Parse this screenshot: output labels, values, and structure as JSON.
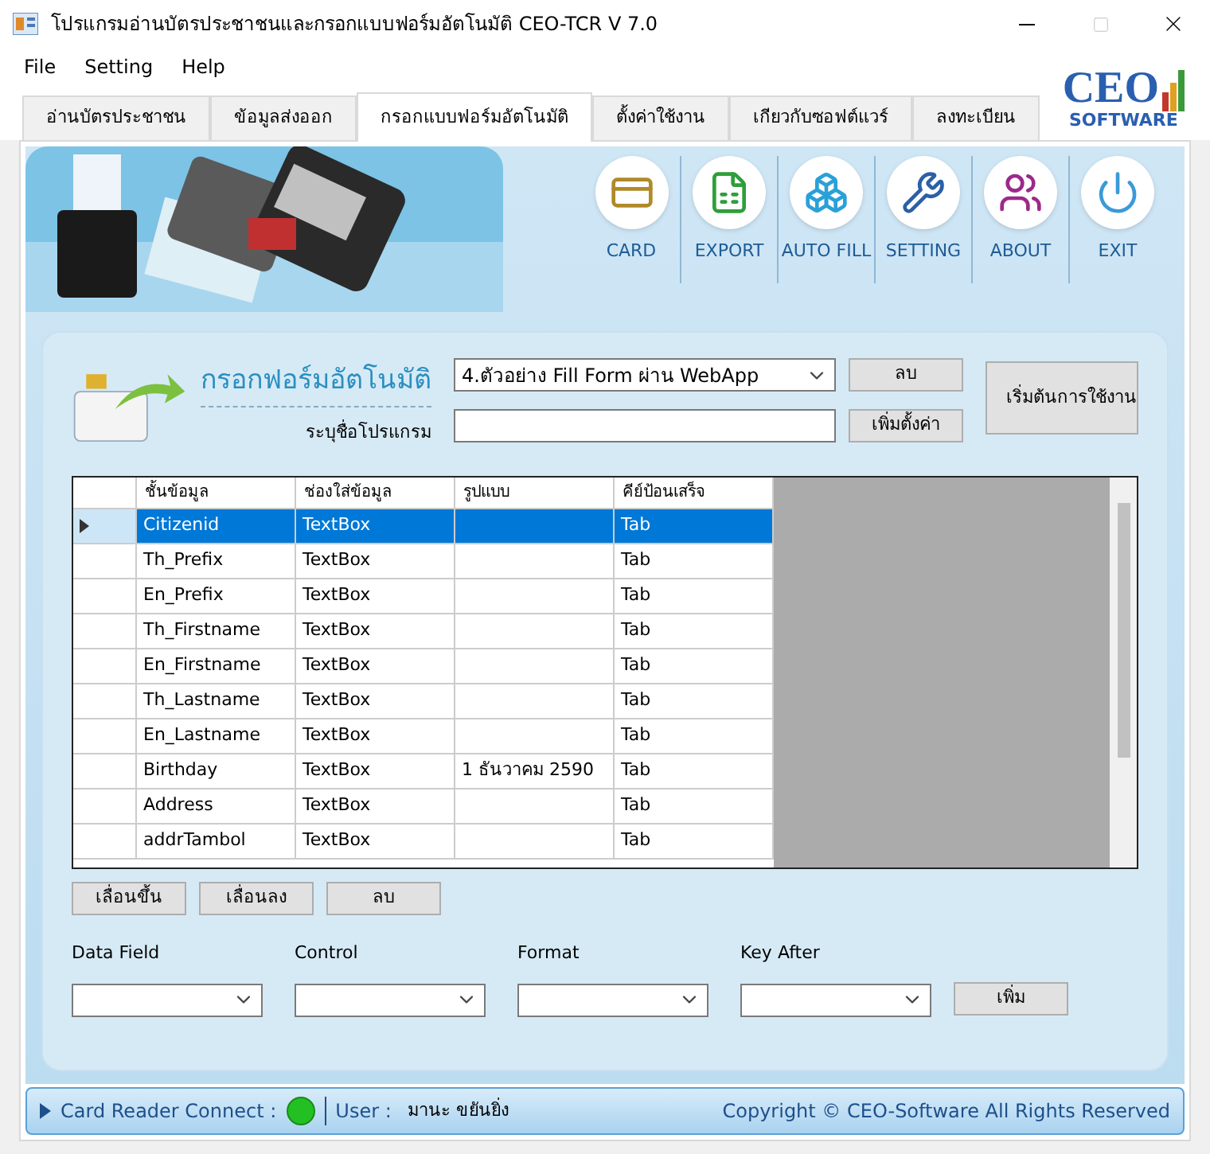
{
  "window": {
    "title": "โปรแกรมอ่านบัตรประชาชนและกรอกแบบฟอร์มอัตโนมัติ CEO-TCR V 7.0"
  },
  "menu": [
    "File",
    "Setting",
    "Help"
  ],
  "logo": {
    "title": "CEO",
    "subtitle": "SOFTWARE"
  },
  "tabs": [
    {
      "label": "อ่านบัตรประชาชน",
      "selected": false
    },
    {
      "label": "ข้อมูลส่งออก",
      "selected": false
    },
    {
      "label": "กรอกแบบฟอร์มอัตโนมัติ",
      "selected": true
    },
    {
      "label": "ตั้งค่าใช้งาน",
      "selected": false
    },
    {
      "label": "เกียวกับซอฟต์แวร์",
      "selected": false
    },
    {
      "label": "ลงทะเบียน",
      "selected": false
    }
  ],
  "toolbar": [
    {
      "kind": "card",
      "label": "CARD"
    },
    {
      "kind": "export",
      "label": "EXPORT"
    },
    {
      "kind": "autofill",
      "label": "AUTO FILL"
    },
    {
      "kind": "setting",
      "label": "SETTING"
    },
    {
      "kind": "about",
      "label": "ABOUT"
    },
    {
      "kind": "exit",
      "label": "EXIT"
    }
  ],
  "form": {
    "heading": "กรอกฟอร์มอัตโนมัติ",
    "profile": "4.ตัวอย่าง Fill Form ผ่าน WebApp",
    "delete_button": "ลบ",
    "program_label": "ระบุชื่อโปรแกรม",
    "add_setting_button": "เพิ่มตั้งค่า",
    "start_button": "เริ่มต้นการใช้งาน"
  },
  "table": {
    "columns": [
      "ชั้นข้อมูล",
      "ช่องใส่ข้อมูล",
      "รูปแบบ",
      "คีย์ป้อนเสร็จ"
    ],
    "rows": [
      {
        "cells": [
          "Citizenid",
          "TextBox",
          "",
          "Tab"
        ],
        "selected": true
      },
      {
        "cells": [
          "Th_Prefix",
          "TextBox",
          "",
          "Tab"
        ],
        "selected": false
      },
      {
        "cells": [
          "En_Prefix",
          "TextBox",
          "",
          "Tab"
        ],
        "selected": false
      },
      {
        "cells": [
          "Th_Firstname",
          "TextBox",
          "",
          "Tab"
        ],
        "selected": false
      },
      {
        "cells": [
          "En_Firstname",
          "TextBox",
          "",
          "Tab"
        ],
        "selected": false
      },
      {
        "cells": [
          "Th_Lastname",
          "TextBox",
          "",
          "Tab"
        ],
        "selected": false
      },
      {
        "cells": [
          "En_Lastname",
          "TextBox",
          "",
          "Tab"
        ],
        "selected": false
      },
      {
        "cells": [
          "Birthday",
          "TextBox",
          "1 ธันวาคม 2590",
          "Tab"
        ],
        "selected": false
      },
      {
        "cells": [
          "Address",
          "TextBox",
          "",
          "Tab"
        ],
        "selected": false
      },
      {
        "cells": [
          "addrTambol",
          "TextBox",
          "",
          "Tab"
        ],
        "selected": false
      }
    ]
  },
  "row_buttons": [
    "เลื่อนขึ้น",
    "เลื่อนลง",
    "ลบ"
  ],
  "fields": [
    {
      "label": "Data Field"
    },
    {
      "label": "Control"
    },
    {
      "label": "Format"
    },
    {
      "label": "Key After"
    }
  ],
  "add_button": "เพิ่ม",
  "status_bar": {
    "connect_label": "Card Reader Connect :",
    "connected": true,
    "user_label": "User :",
    "user": "มานะ ขยันยิ่ง",
    "copyright": "Copyright © CEO-Software All Rights Reserved"
  }
}
